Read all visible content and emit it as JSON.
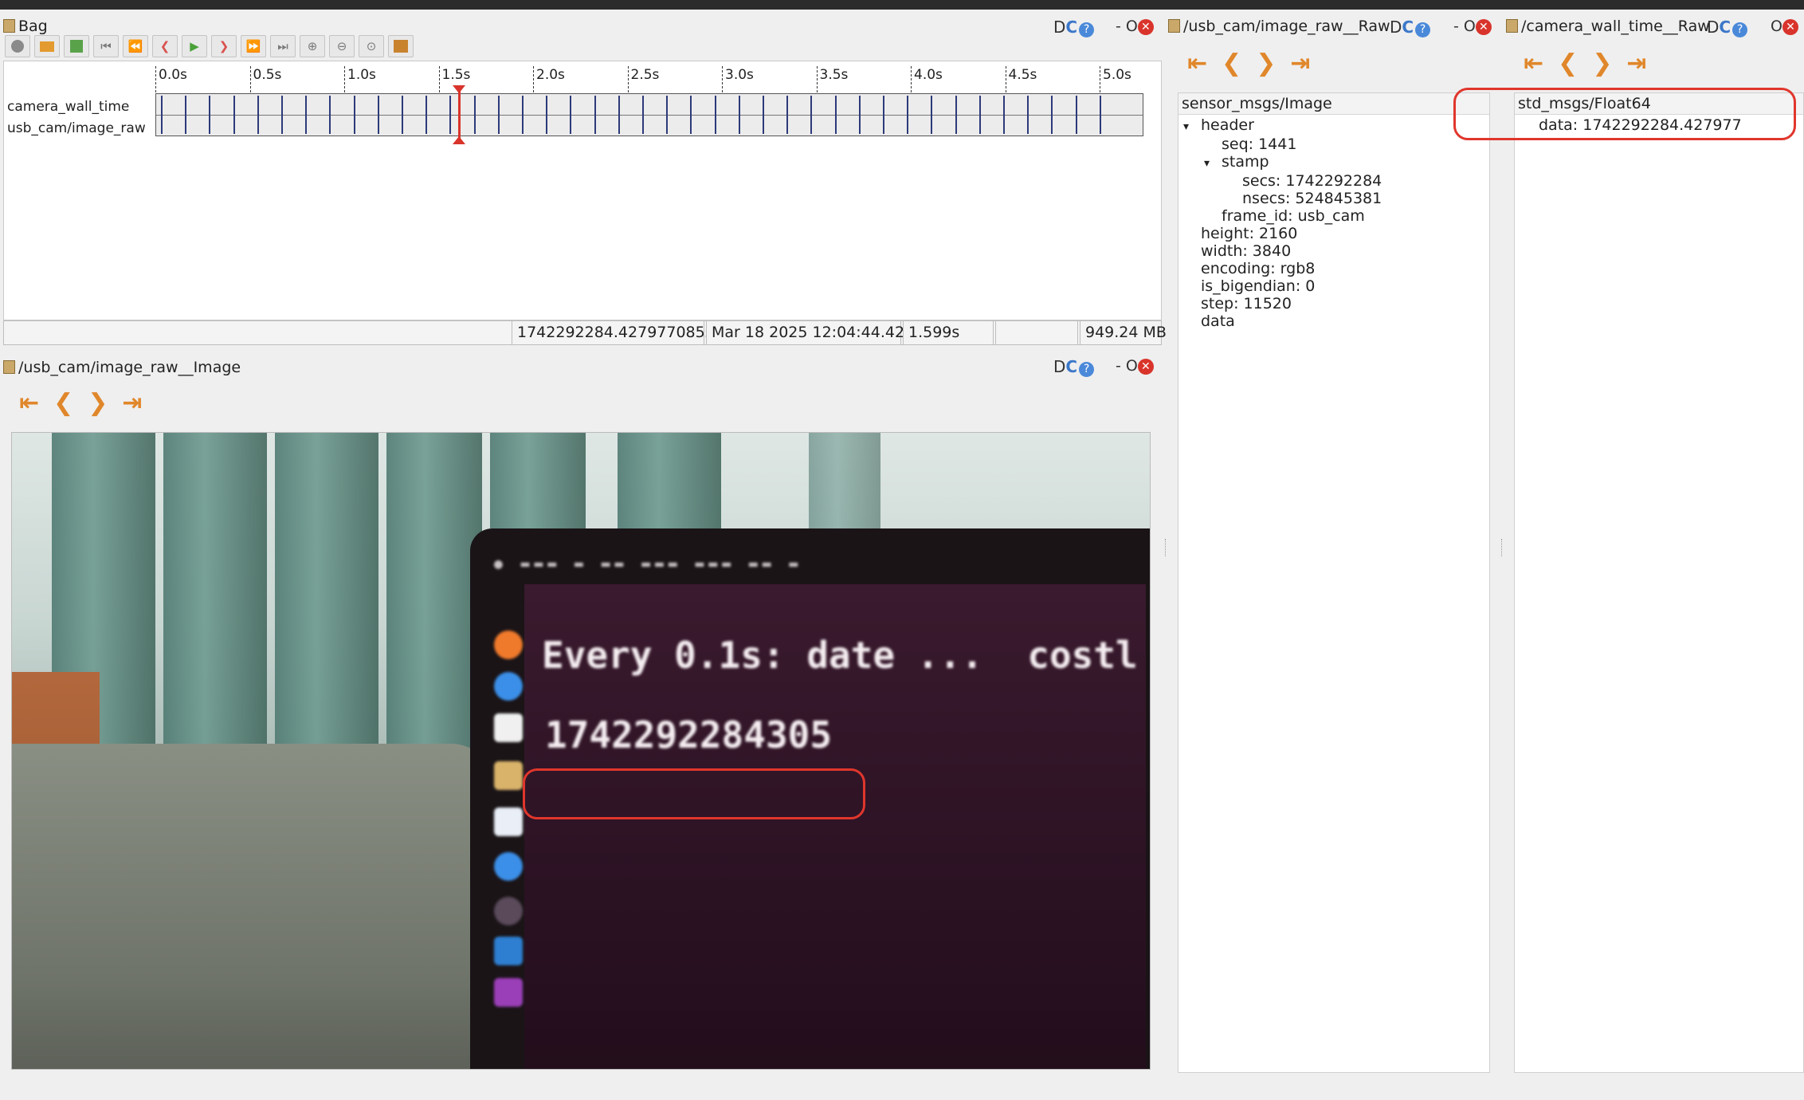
{
  "bag_panel": {
    "title": "Bag",
    "timeline": {
      "ticks": [
        "0.0s",
        "0.5s",
        "1.0s",
        "1.5s",
        "2.0s",
        "2.5s",
        "3.0s",
        "3.5s",
        "4.0s",
        "4.5s",
        "5.0s"
      ],
      "topics": [
        "camera_wall_time",
        "usb_cam/image_raw"
      ]
    },
    "status": {
      "timestamp": "1742292284.427977085s",
      "date": "Mar 18 2025 12:04:44.427",
      "elapsed": "1.599s",
      "size": "949.24 MB"
    }
  },
  "image_panel": {
    "title": "/usb_cam/image_raw__Image",
    "screen_text": {
      "line1": "Every 0.1s: date ...",
      "line1_tail": "costl",
      "timestamp": "1742292284305"
    }
  },
  "raw_panel_1": {
    "title": "/usb_cam/image_raw__Raw",
    "msg_type": "sensor_msgs/Image",
    "rows": [
      {
        "indent": 0,
        "arrow": "▾",
        "text": "header"
      },
      {
        "indent": 1,
        "arrow": "",
        "text": "seq:  1441"
      },
      {
        "indent": 1,
        "arrow": "▾",
        "text": "stamp"
      },
      {
        "indent": 2,
        "arrow": "",
        "text": "secs:  1742292284"
      },
      {
        "indent": 2,
        "arrow": "",
        "text": "nsecs:  524845381"
      },
      {
        "indent": 1,
        "arrow": "",
        "text": "frame_id: usb_cam"
      },
      {
        "indent": 0,
        "arrow": "",
        "text": "height:  2160"
      },
      {
        "indent": 0,
        "arrow": "",
        "text": "width:  3840"
      },
      {
        "indent": 0,
        "arrow": "",
        "text": "encoding: rgb8"
      },
      {
        "indent": 0,
        "arrow": "",
        "text": "is_bigendian:  0"
      },
      {
        "indent": 0,
        "arrow": "",
        "text": "step:  11520"
      },
      {
        "indent": 0,
        "arrow": "",
        "text": "data"
      }
    ]
  },
  "raw_panel_2": {
    "title": "/camera_wall_time__Raw",
    "msg_type": "std_msgs/Float64",
    "data_row": "data:  1742292284.427977"
  },
  "panel_controls": {
    "d": "D",
    "c": "C",
    "q": "?",
    "dash": "-",
    "o": "O",
    "x": "✕"
  },
  "colors": {
    "accent_orange": "#e0872b",
    "highlight_red": "#e0362c",
    "msg_tick": "#2d3a7a"
  }
}
